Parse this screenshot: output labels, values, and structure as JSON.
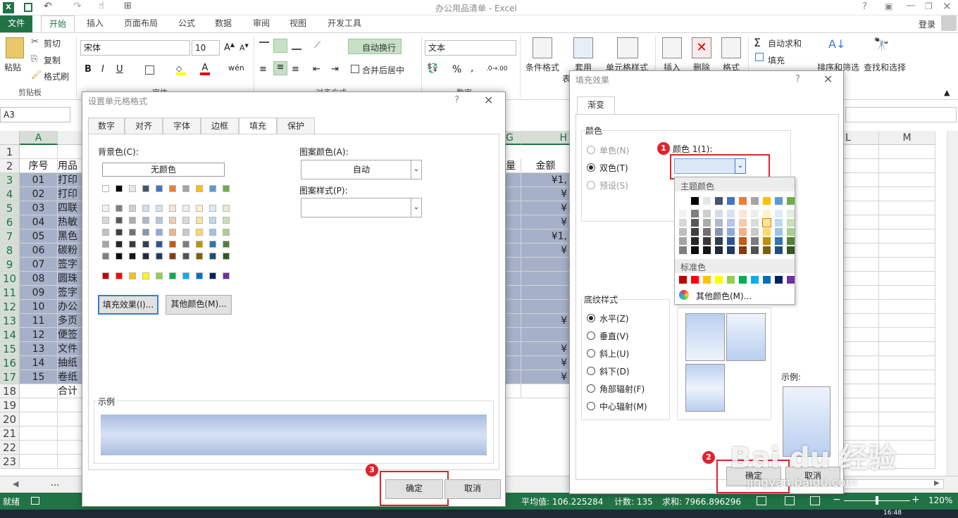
{
  "window": {
    "title": "办公用品清单 - Excel",
    "login": "登录"
  },
  "tabs": [
    "文件",
    "开始",
    "插入",
    "页面布局",
    "公式",
    "数据",
    "审阅",
    "视图",
    "开发工具"
  ],
  "ribbon": {
    "clipboard": {
      "paste": "粘贴",
      "cut": "剪切",
      "copy": "复制",
      "painter": "格式刷",
      "group": "剪贴板"
    },
    "font": {
      "name": "宋体",
      "size": "10",
      "group": "字体"
    },
    "align": {
      "wrap": "自动换行",
      "merge": "合并后居中",
      "group": "对齐方式"
    },
    "number": {
      "format": "文本",
      "group": "数字"
    },
    "styles": {
      "cond": "条件格式",
      "table": "套用",
      "table2": "表",
      "cellstyle": "单元格样式"
    },
    "cells": {
      "insert": "插入",
      "delete": "删除",
      "format": "格式"
    },
    "editing": {
      "autosum": "自动求和",
      "fill": "填充",
      "sort": "排序和筛选",
      "find": "查找和选择"
    }
  },
  "namebox": "A3",
  "columns": [
    "A",
    "G",
    "H",
    "L",
    "M"
  ],
  "rows": [
    "1",
    "2",
    "3",
    "4",
    "5",
    "6",
    "7",
    "8",
    "9",
    "10",
    "11",
    "12",
    "13",
    "14",
    "15",
    "16",
    "17",
    "18",
    "19",
    "20",
    "21",
    "22",
    "23"
  ],
  "header": {
    "a": "序号",
    "b": "用品",
    "g": "量",
    "h": "金额"
  },
  "seq": [
    "01",
    "02",
    "03",
    "04",
    "05",
    "06",
    "07",
    "08",
    "09",
    "10",
    "11",
    "12",
    "13",
    "14",
    "15"
  ],
  "items": [
    "打印",
    "打印",
    "四联",
    "热敏",
    "黑色",
    "碳粉",
    "签字",
    "圆珠",
    "签字",
    "办公",
    "多页",
    "便签",
    "文件",
    "抽纸",
    "卷纸"
  ],
  "amounts": [
    "¥1,",
    "¥",
    "¥",
    "¥",
    "¥1,",
    "¥",
    "",
    "",
    "",
    "",
    "¥",
    "",
    "¥",
    "¥",
    "¥"
  ],
  "total_label": "合计",
  "sheet": {
    "more": "..."
  },
  "status": {
    "ready": "就绪",
    "avg": "平均值: 106.225284",
    "count": "计数: 135",
    "sum": "求和: 7966.896296",
    "zoom": "120%",
    "time": "16:48"
  },
  "format_dialog": {
    "title": "设置单元格格式",
    "tabs": [
      "数字",
      "对齐",
      "字体",
      "边框",
      "填充",
      "保护"
    ],
    "bg_label": "背景色(C):",
    "no_color": "无颜色",
    "pattern_color_label": "图案颜色(A):",
    "pattern_color": "自动",
    "pattern_style_label": "图案样式(P):",
    "fill_effects": "填充效果(I)...",
    "more_colors": "其他颜色(M)...",
    "sample": "示例",
    "ok": "确定",
    "cancel": "取消",
    "badge": "3"
  },
  "fill_dialog": {
    "title": "填充效果",
    "tab": "渐变",
    "colors_label": "颜色",
    "one_color": "单色(N)",
    "two_colors": "双色(T)",
    "preset": "预设(S)",
    "color1": "颜色 1(1):",
    "theme_colors": "主题颜色",
    "standard_colors": "标准色",
    "more_colors": "其他颜色(M)...",
    "shading_label": "底纹样式",
    "shading": [
      "水平(Z)",
      "垂直(V)",
      "斜上(U)",
      "斜下(D)",
      "角部辐射(F)",
      "中心辐射(M)"
    ],
    "sample": "示例:",
    "ok": "确定",
    "cancel": "取消",
    "badge1": "1",
    "badge2": "2"
  },
  "watermark": {
    "brand": "Bai du 经验",
    "url": "jingyan.baidu.com"
  }
}
